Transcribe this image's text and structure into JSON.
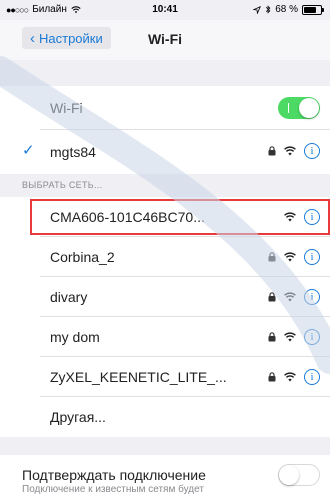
{
  "status_bar": {
    "signal_dots": "●●○○○",
    "carrier": "Билайн",
    "time": "10:41",
    "battery_percent": "68 %",
    "battery_level": 0.68
  },
  "nav": {
    "back_label": "Настройки",
    "title": "Wi-Fi"
  },
  "wifi_toggle": {
    "label": "Wi-Fi",
    "state": "on"
  },
  "connected": {
    "name": "mgts84",
    "secured": true
  },
  "choose_network_header": "ВЫБРАТЬ СЕТЬ...",
  "networks": [
    {
      "name": "CMA606-101C46BC70...",
      "secured": false
    },
    {
      "name": "Corbina_2",
      "secured": true
    },
    {
      "name": "divary",
      "secured": true
    },
    {
      "name": "my dom",
      "secured": true
    },
    {
      "name": "ZyXEL_KEENETIC_LITE_...",
      "secured": true
    },
    {
      "name": "Другая...",
      "secured": false,
      "other": true
    }
  ],
  "ask_to_join": {
    "label": "Подтверждать подключение",
    "state": "off"
  },
  "footer_text": "Подключение к известным сетям будет",
  "colors": {
    "accent": "#1a7ad6",
    "toggle_on": "#4cd964",
    "highlight": "#e83a3a",
    "background": "#efeff4"
  },
  "icons": {
    "check": "checkmark-icon",
    "lock": "lock-icon",
    "wifi": "wifi-icon",
    "info": "info-icon"
  }
}
